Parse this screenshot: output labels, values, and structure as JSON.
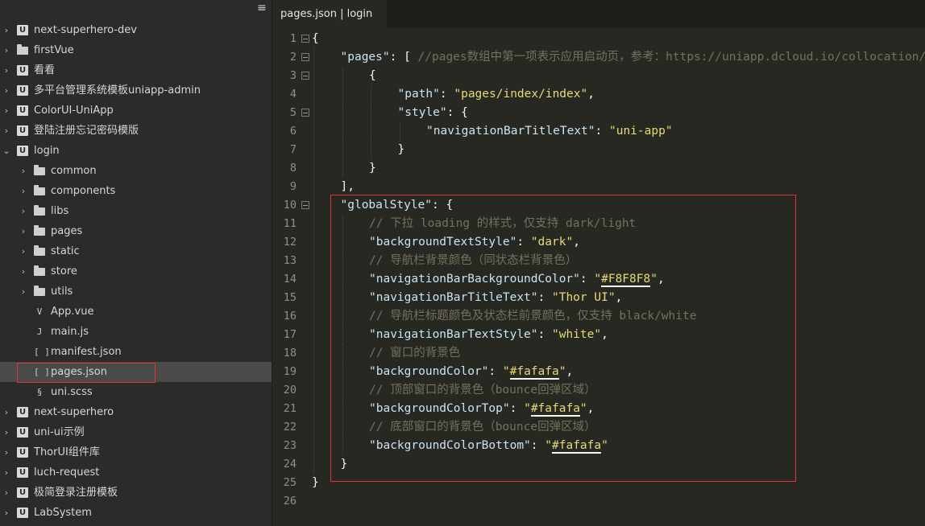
{
  "sidebar": {
    "menu_icon": "≡",
    "items": [
      {
        "label": "next-superhero-dev",
        "type": "project",
        "indent": 0,
        "chev": "›"
      },
      {
        "label": "firstVue",
        "type": "folder",
        "indent": 0,
        "chev": "›"
      },
      {
        "label": "看看",
        "type": "project",
        "indent": 0,
        "chev": "›"
      },
      {
        "label": "多平台管理系统模板uniapp-admin",
        "type": "project",
        "indent": 0,
        "chev": "›"
      },
      {
        "label": "ColorUI-UniApp",
        "type": "project",
        "indent": 0,
        "chev": "›"
      },
      {
        "label": "登陆注册忘记密码模版",
        "type": "project",
        "indent": 0,
        "chev": "›"
      },
      {
        "label": "login",
        "type": "project",
        "indent": 0,
        "chev": "⌄"
      },
      {
        "label": "common",
        "type": "folder",
        "indent": 1,
        "chev": "›"
      },
      {
        "label": "components",
        "type": "folder",
        "indent": 1,
        "chev": "›"
      },
      {
        "label": "libs",
        "type": "folder",
        "indent": 1,
        "chev": "›"
      },
      {
        "label": "pages",
        "type": "folder",
        "indent": 1,
        "chev": "›"
      },
      {
        "label": "static",
        "type": "folder",
        "indent": 1,
        "chev": "›"
      },
      {
        "label": "store",
        "type": "folder",
        "indent": 1,
        "chev": "›"
      },
      {
        "label": "utils",
        "type": "folder",
        "indent": 1,
        "chev": "›"
      },
      {
        "label": "App.vue",
        "type": "file",
        "indent": 1,
        "chev": "",
        "glyph": "V"
      },
      {
        "label": "main.js",
        "type": "file",
        "indent": 1,
        "chev": "",
        "glyph": "J"
      },
      {
        "label": "manifest.json",
        "type": "file",
        "indent": 1,
        "chev": "",
        "glyph": "[ ]"
      },
      {
        "label": "pages.json",
        "type": "file",
        "indent": 1,
        "chev": "",
        "glyph": "[ ]",
        "selected": true
      },
      {
        "label": "uni.scss",
        "type": "file",
        "indent": 1,
        "chev": "",
        "glyph": "§"
      },
      {
        "label": "next-superhero",
        "type": "project",
        "indent": 0,
        "chev": "›"
      },
      {
        "label": "uni-ui示例",
        "type": "project",
        "indent": 0,
        "chev": "›"
      },
      {
        "label": "ThorUI组件库",
        "type": "project",
        "indent": 0,
        "chev": "›"
      },
      {
        "label": "luch-request",
        "type": "project",
        "indent": 0,
        "chev": "›"
      },
      {
        "label": "极简登录注册模板",
        "type": "project",
        "indent": 0,
        "chev": "›"
      },
      {
        "label": "LabSystem",
        "type": "project",
        "indent": 0,
        "chev": "›"
      }
    ]
  },
  "tab": {
    "label": "pages.json | login"
  },
  "editor": {
    "lines": [
      {
        "n": "1",
        "fold": true,
        "indent": 0,
        "tokens": [
          [
            "p",
            "{"
          ]
        ]
      },
      {
        "n": "2",
        "fold": true,
        "indent": 1,
        "tokens": [
          [
            "k",
            "\"pages\""
          ],
          [
            "p",
            ": [ "
          ],
          [
            "c",
            "//pages数组中第一项表示应用启动页，参考：https://uniapp.dcloud.io/collocation/pages"
          ]
        ]
      },
      {
        "n": "3",
        "fold": true,
        "indent": 2,
        "tokens": [
          [
            "p",
            "{"
          ]
        ]
      },
      {
        "n": "4",
        "fold": false,
        "indent": 3,
        "tokens": [
          [
            "k",
            "\"path\""
          ],
          [
            "p",
            ": "
          ],
          [
            "s",
            "\"pages/index/index\""
          ],
          [
            "p",
            ","
          ]
        ]
      },
      {
        "n": "5",
        "fold": true,
        "indent": 3,
        "tokens": [
          [
            "k",
            "\"style\""
          ],
          [
            "p",
            ": {"
          ]
        ]
      },
      {
        "n": "6",
        "fold": false,
        "indent": 4,
        "tokens": [
          [
            "k",
            "\"navigationBarTitleText\""
          ],
          [
            "p",
            ": "
          ],
          [
            "s",
            "\"uni-app\""
          ]
        ]
      },
      {
        "n": "7",
        "fold": false,
        "indent": 3,
        "tokens": [
          [
            "p",
            "}"
          ]
        ]
      },
      {
        "n": "8",
        "fold": false,
        "indent": 2,
        "tokens": [
          [
            "p",
            "}"
          ]
        ]
      },
      {
        "n": "9",
        "fold": false,
        "indent": 1,
        "tokens": [
          [
            "p",
            "],"
          ]
        ]
      },
      {
        "n": "10",
        "fold": true,
        "indent": 1,
        "tokens": [
          [
            "k",
            "\"globalStyle\""
          ],
          [
            "p",
            ": {"
          ]
        ]
      },
      {
        "n": "11",
        "fold": false,
        "indent": 2,
        "tokens": [
          [
            "c",
            "// 下拉 loading 的样式，仅支持 dark/light"
          ]
        ]
      },
      {
        "n": "12",
        "fold": false,
        "indent": 2,
        "tokens": [
          [
            "k",
            "\"backgroundTextStyle\""
          ],
          [
            "p",
            ": "
          ],
          [
            "s",
            "\"dark\""
          ],
          [
            "p",
            ","
          ]
        ]
      },
      {
        "n": "13",
        "fold": false,
        "indent": 2,
        "tokens": [
          [
            "c",
            "// 导航栏背景颜色（同状态栏背景色）"
          ]
        ]
      },
      {
        "n": "14",
        "fold": false,
        "indent": 2,
        "tokens": [
          [
            "k",
            "\"navigationBarBackgroundColor\""
          ],
          [
            "p",
            ": "
          ],
          [
            "s",
            "\""
          ],
          [
            "s hl",
            "#F8F8F8"
          ],
          [
            "s",
            "\""
          ],
          [
            "p",
            ","
          ]
        ]
      },
      {
        "n": "15",
        "fold": false,
        "indent": 2,
        "tokens": [
          [
            "k",
            "\"navigationBarTitleText\""
          ],
          [
            "p",
            ": "
          ],
          [
            "s",
            "\"Thor UI\""
          ],
          [
            "p",
            ","
          ]
        ]
      },
      {
        "n": "16",
        "fold": false,
        "indent": 2,
        "tokens": [
          [
            "c",
            "// 导航栏标题颜色及状态栏前景颜色，仅支持 black/white"
          ]
        ]
      },
      {
        "n": "17",
        "fold": false,
        "indent": 2,
        "tokens": [
          [
            "k",
            "\"navigationBarTextStyle\""
          ],
          [
            "p",
            ": "
          ],
          [
            "s",
            "\"white\""
          ],
          [
            "p",
            ","
          ]
        ]
      },
      {
        "n": "18",
        "fold": false,
        "indent": 2,
        "tokens": [
          [
            "c",
            "// 窗口的背景色"
          ]
        ]
      },
      {
        "n": "19",
        "fold": false,
        "indent": 2,
        "tokens": [
          [
            "k",
            "\"backgroundColor\""
          ],
          [
            "p",
            ": "
          ],
          [
            "s",
            "\""
          ],
          [
            "s hl",
            "#fafafa"
          ],
          [
            "s",
            "\""
          ],
          [
            "p",
            ","
          ]
        ]
      },
      {
        "n": "20",
        "fold": false,
        "indent": 2,
        "tokens": [
          [
            "c",
            "// 顶部窗口的背景色（bounce回弹区域）"
          ]
        ]
      },
      {
        "n": "21",
        "fold": false,
        "indent": 2,
        "tokens": [
          [
            "k",
            "\"backgroundColorTop\""
          ],
          [
            "p",
            ": "
          ],
          [
            "s",
            "\""
          ],
          [
            "s hl",
            "#fafafa"
          ],
          [
            "s",
            "\""
          ],
          [
            "p",
            ","
          ]
        ]
      },
      {
        "n": "22",
        "fold": false,
        "indent": 2,
        "tokens": [
          [
            "c",
            "// 底部窗口的背景色（bounce回弹区域）"
          ]
        ]
      },
      {
        "n": "23",
        "fold": false,
        "indent": 2,
        "tokens": [
          [
            "k",
            "\"backgroundColorBottom\""
          ],
          [
            "p",
            ": "
          ],
          [
            "s",
            "\""
          ],
          [
            "s hl",
            "#fafafa"
          ],
          [
            "s",
            "\""
          ]
        ]
      },
      {
        "n": "24",
        "fold": false,
        "indent": 1,
        "tokens": [
          [
            "p",
            "}"
          ]
        ]
      },
      {
        "n": "25",
        "fold": false,
        "indent": 0,
        "tokens": [
          [
            "p",
            "}"
          ]
        ]
      },
      {
        "n": "26",
        "fold": false,
        "indent": 0,
        "tokens": []
      }
    ]
  },
  "colors": {
    "accent_box": "#e0343b",
    "string": "#e6db74",
    "comment": "#75715e",
    "key": "#c9e4f5"
  }
}
